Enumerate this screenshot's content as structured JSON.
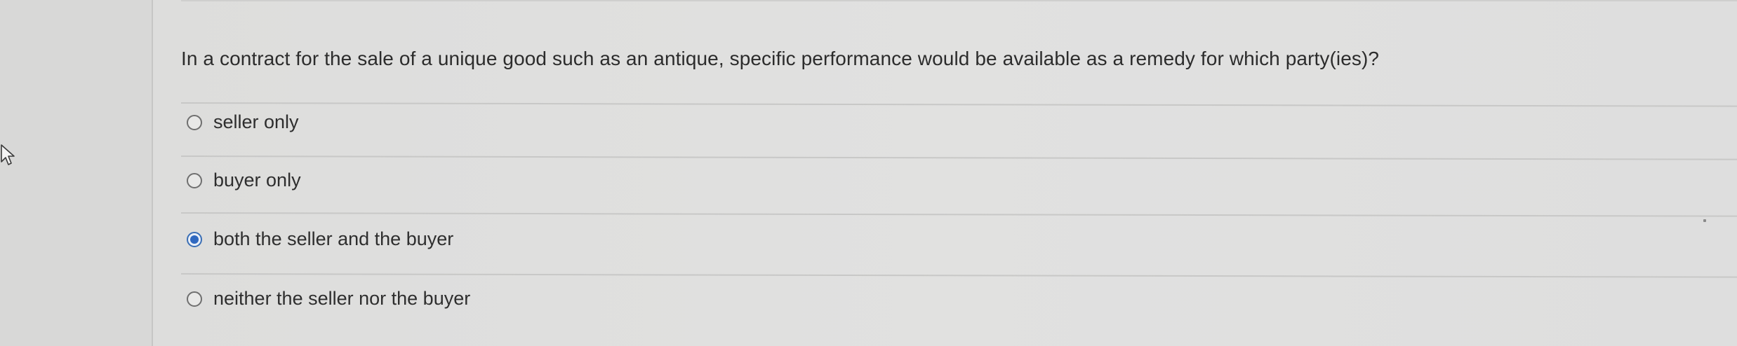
{
  "question": {
    "text": "In a contract for the sale of a unique good such as an antique, specific performance would be available as a remedy for which party(ies)?"
  },
  "options": [
    {
      "label": "seller only",
      "selected": false
    },
    {
      "label": "buyer only",
      "selected": false
    },
    {
      "label": "both the seller and the buyer",
      "selected": true
    },
    {
      "label": "neither the seller nor the buyer",
      "selected": false
    }
  ],
  "colors": {
    "selected_radio": "#2f68c0",
    "text": "#2c2c2c",
    "background": "#dedede"
  },
  "icons": {
    "cursor": "pointer-cursor-icon"
  }
}
